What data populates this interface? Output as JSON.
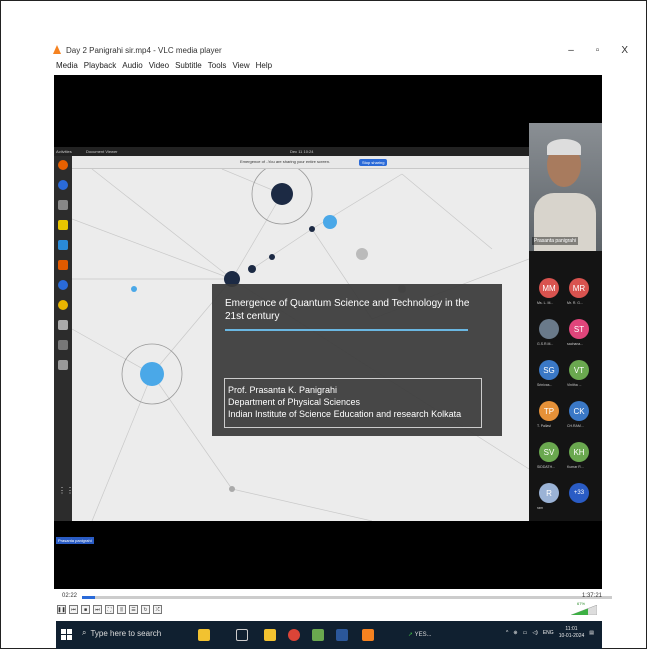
{
  "vlc": {
    "title": "Day 2 Panigrahi sir.mp4 - VLC media player",
    "minimize": "–",
    "maximize": "▫",
    "close": "X",
    "menu": [
      "Media",
      "Playback",
      "Audio",
      "Video",
      "Subtitle",
      "Tools",
      "View",
      "Help"
    ],
    "elapsed": "02:22",
    "total": "1:37:21",
    "progress_fraction": 0.024,
    "volume_percent": "67%"
  },
  "meeting": {
    "activities": "Activities",
    "doc_viewer": "Document Viewer",
    "clock": "Dec 11 10:24",
    "doc_title_short": "Emergence of ...",
    "sharing_text": "You are sharing your entire screen.",
    "stop_sharing": "Stop sharing",
    "presenter_name": "Prasanta panigrahi",
    "participants": [
      {
        "initials": "MM",
        "label": "Ms. L. M...",
        "color": "#d9534f"
      },
      {
        "initials": "MR",
        "label": "Mr. R. G...",
        "color": "#d9534f"
      },
      {
        "initials": "",
        "label": "G.S.R.M...",
        "color": "#6a7a8a"
      },
      {
        "initials": "ST",
        "label": "sachana...",
        "color": "#e0457b"
      },
      {
        "initials": "SG",
        "label": "Srinivas...",
        "color": "#3a78c6"
      },
      {
        "initials": "VT",
        "label": "Vinitha ...",
        "color": "#6aa84f"
      },
      {
        "initials": "TP",
        "label": "T. Pallavi",
        "color": "#e69138"
      },
      {
        "initials": "CK",
        "label": "CH.RAM...",
        "color": "#3a78c6"
      },
      {
        "initials": "SV",
        "label": "SIDDATH...",
        "color": "#6aa84f"
      },
      {
        "initials": "KH",
        "label": "Kumar R...",
        "color": "#6aa84f"
      },
      {
        "initials": "R",
        "label": "ram",
        "color": "#9bb3d6"
      },
      {
        "initials": "+33",
        "label": "",
        "color": "#2a5cc5"
      }
    ]
  },
  "slide": {
    "title": "Emergence of Quantum Science and Technology in the 21st century",
    "author": "Prof. Prasanta K. Panigrahi",
    "department": "Department of Physical Sciences",
    "institute": "Indian Institute of Science Education and research Kolkata"
  },
  "taskbar": {
    "search_placeholder": "Type here to search",
    "yes_label": "YES...",
    "lang": "ENG",
    "time": "11:01",
    "date": "10-01-2024"
  },
  "colors": {
    "accent_blue": "#4aa8e8",
    "vlc_orange": "#f58220",
    "title_rule": "#6ab7e2"
  }
}
